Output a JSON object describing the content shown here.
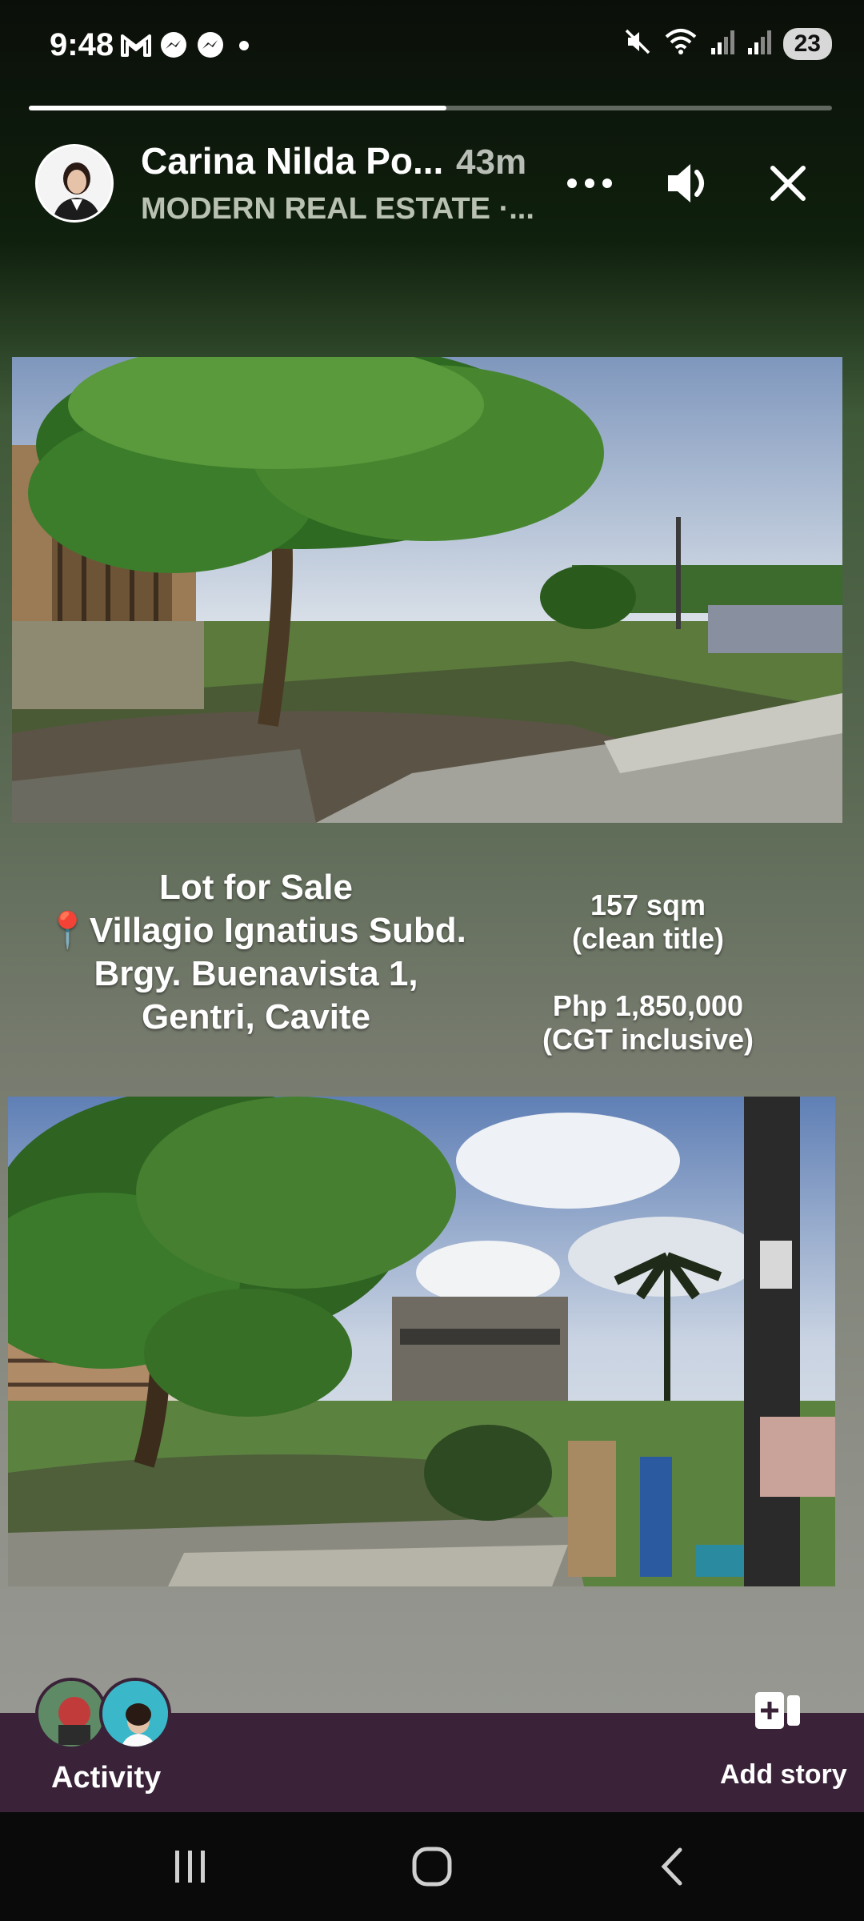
{
  "status_bar": {
    "time": "9:48",
    "notification_icons": [
      "gmail-icon",
      "messenger-icon",
      "messenger-icon",
      "dot-icon"
    ],
    "right_icons": [
      "mute-icon",
      "wifi-icon",
      "signal-icon",
      "signal-icon"
    ],
    "battery": "23"
  },
  "story": {
    "progress_fraction": 0.52,
    "author": "Carina Nilda Po...",
    "elapsed": "43m",
    "page_name": "MODERN REAL ESTATE ·...",
    "controls": [
      "more-icon",
      "volume-icon",
      "close-icon"
    ]
  },
  "listing": {
    "title": "Lot for Sale",
    "pin": "📍",
    "subdivision": "Villagio Ignatius Subd.",
    "barangay": "Brgy. Buenavista 1,",
    "city": "Gentri, Cavite",
    "area": "157 sqm",
    "title_status": "(clean title)",
    "price": "Php 1,850,000",
    "price_note": "(CGT inclusive)"
  },
  "footer": {
    "activity_label": "Activity",
    "add_story_label": "Add story"
  },
  "colors": {
    "activity_bar": "#3a2238",
    "accent_white": "#ffffff"
  }
}
